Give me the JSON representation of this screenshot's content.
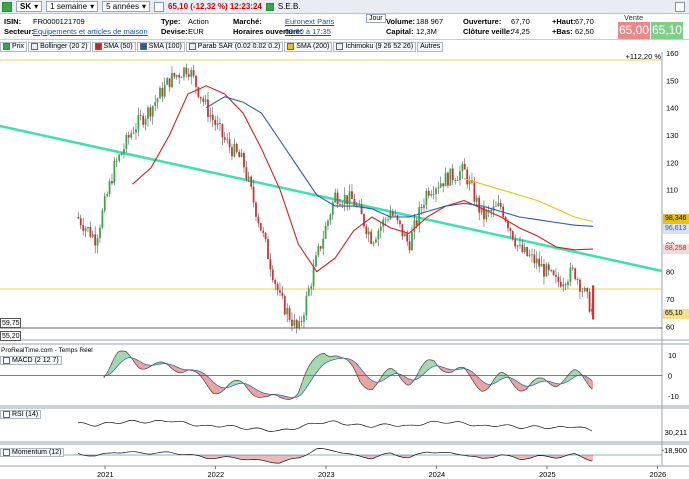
{
  "toolbar": {
    "symbol": "SK",
    "period": "1 semaine",
    "range": "5 années",
    "last_quote": "65,10 (-12,32 %) 12:23:24",
    "company": "S.E.B."
  },
  "info": {
    "isin_label": "ISIN:",
    "isin_value": "FR0000121709",
    "secteur_label": "Secteur:",
    "secteur_value": "Equipements et articles de maison",
    "type_label": "Type:",
    "type_value": "Action",
    "devise_label": "Devise:",
    "devise_value": "EUR",
    "marche_label": "Marché:",
    "marche_value": "Euronext Paris",
    "horaires_label": "Horaires ouverture:",
    "horaires_value": "09:00 à 17:35",
    "jour_label": "Jour",
    "volume_label": "Volume:",
    "volume_value": "188 967",
    "capital_label": "Capital:",
    "capital_value": "12,3M",
    "ouverture_label": "Ouverture:",
    "ouverture_value": "67,70",
    "cloture_label": "Clôture veille:",
    "cloture_value": "74,25",
    "haut_label": "+Haut:",
    "haut_value": "67,70",
    "bas_label": "+Bas:",
    "bas_value": "62,50",
    "vente_label": "Vente",
    "vente_value": "65,00",
    "achat_value": "65,10"
  },
  "legend": [
    {
      "label": "Prix",
      "color": "#3aa64a"
    },
    {
      "label": "Bollinger (20 2)",
      "color": "#888888"
    },
    {
      "label": "SMA (50)",
      "color": "#cc2222"
    },
    {
      "label": "SMA (100)",
      "color": "#2b58b5"
    },
    {
      "label": "Parab SAR (0.02 0.02 0.2)",
      "color": "#999999"
    },
    {
      "label": "SMA (200)",
      "color": "#e8c020"
    },
    {
      "label": "Ichimoku (9 26 52 26)",
      "color": "#777777"
    },
    {
      "label": "Autres",
      "color": ""
    }
  ],
  "source_label": "ProRealTime.com - Temps Réel",
  "indicators": {
    "macd_label": "MACD (2 12 7)",
    "rsi_label": "RSI (14)",
    "rsi_value": "30,211",
    "momentum_label": "Momentum (12)",
    "momentum_value": "-18,900"
  },
  "price_tags": {
    "pct": "+112,20 %",
    "sma200": "98,346",
    "sma100": "96,613",
    "sma50": "88,258",
    "last": "65,10",
    "lvl1": "59,75",
    "lvl2": "55,20"
  },
  "colors": {
    "up": "#3aa64a",
    "down": "#cc3333",
    "sma50": "#cc2222",
    "sma100": "#2b58b5",
    "sma200": "#e8c020",
    "trend": "#3de0b0",
    "vente": "#e88a8a",
    "achat": "#7fcf8b"
  },
  "chart_data": [
    {
      "type": "line",
      "title": "",
      "x": [
        "2020-10",
        "2020-12",
        "2021-02",
        "2021-04",
        "2021-06",
        "2021-08",
        "2021-10",
        "2021-12",
        "2022-02",
        "2022-04",
        "2022-06",
        "2022-08",
        "2022-10",
        "2022-12",
        "2023-02",
        "2023-04",
        "2023-06",
        "2023-08",
        "2023-10",
        "2023-12",
        "2024-02",
        "2024-04",
        "2024-06",
        "2024-08",
        "2024-10",
        "2024-12",
        "2025-02",
        "2025-04",
        "2025-06"
      ],
      "series": [
        {
          "name": "Prix",
          "values": [
            100,
            92,
            118,
            132,
            140,
            150,
            155,
            140,
            128,
            120,
            95,
            70,
            58,
            85,
            108,
            106,
            92,
            102,
            90,
            110,
            114,
            117,
            100,
            104,
            88,
            83,
            76,
            80,
            65.1
          ]
        },
        {
          "name": "SMA (50)",
          "values": [
            null,
            null,
            null,
            112,
            118,
            130,
            145,
            148,
            145,
            138,
            125,
            110,
            90,
            80,
            85,
            95,
            100,
            96,
            94,
            100,
            104,
            106,
            103,
            100,
            96,
            93,
            89,
            88,
            88.26
          ]
        },
        {
          "name": "SMA (100)",
          "values": [
            null,
            null,
            null,
            null,
            null,
            null,
            null,
            140,
            144,
            142,
            138,
            128,
            118,
            108,
            104,
            104,
            103,
            100,
            100,
            102,
            104,
            105,
            104,
            102,
            100,
            99,
            98,
            97,
            96.61
          ]
        },
        {
          "name": "SMA (200)",
          "values": [
            null,
            null,
            null,
            null,
            null,
            null,
            null,
            null,
            null,
            null,
            null,
            null,
            null,
            null,
            null,
            null,
            null,
            null,
            null,
            null,
            null,
            114,
            112,
            110,
            108,
            106,
            103,
            100,
            98.35
          ]
        }
      ],
      "xlabels": [
        "2021",
        "2022",
        "2023",
        "2024",
        "2025",
        "2026"
      ],
      "ylim": [
        55,
        160
      ],
      "yticks": [
        60,
        70,
        80,
        90,
        100,
        110,
        120,
        130,
        140,
        150,
        160
      ],
      "grid": false,
      "legend_placement": "top-left"
    },
    {
      "type": "line",
      "title": "MACD (2 12 7)",
      "yticks": [
        10,
        0,
        -10
      ],
      "ylim": [
        -14,
        14
      ]
    },
    {
      "type": "line",
      "title": "RSI (14)",
      "series": [
        {
          "name": "RSI (14)",
          "values": [
            55,
            50,
            58,
            62,
            60,
            65,
            55,
            45,
            48,
            40,
            35,
            30,
            42,
            58,
            60,
            50,
            46,
            52,
            45,
            58,
            60,
            56,
            45,
            50,
            42,
            44,
            40,
            46,
            30.211
          ]
        }
      ]
    },
    {
      "type": "line",
      "title": "Momentum (12)",
      "series": [
        {
          "name": "Momentum (12)",
          "values": [
            5,
            -4,
            10,
            8,
            6,
            8,
            2,
            -10,
            -8,
            -12,
            -20,
            -25,
            -10,
            20,
            15,
            -2,
            -10,
            6,
            -10,
            12,
            6,
            2,
            -14,
            2,
            -14,
            -4,
            -8,
            2,
            -18.9
          ]
        }
      ]
    }
  ]
}
